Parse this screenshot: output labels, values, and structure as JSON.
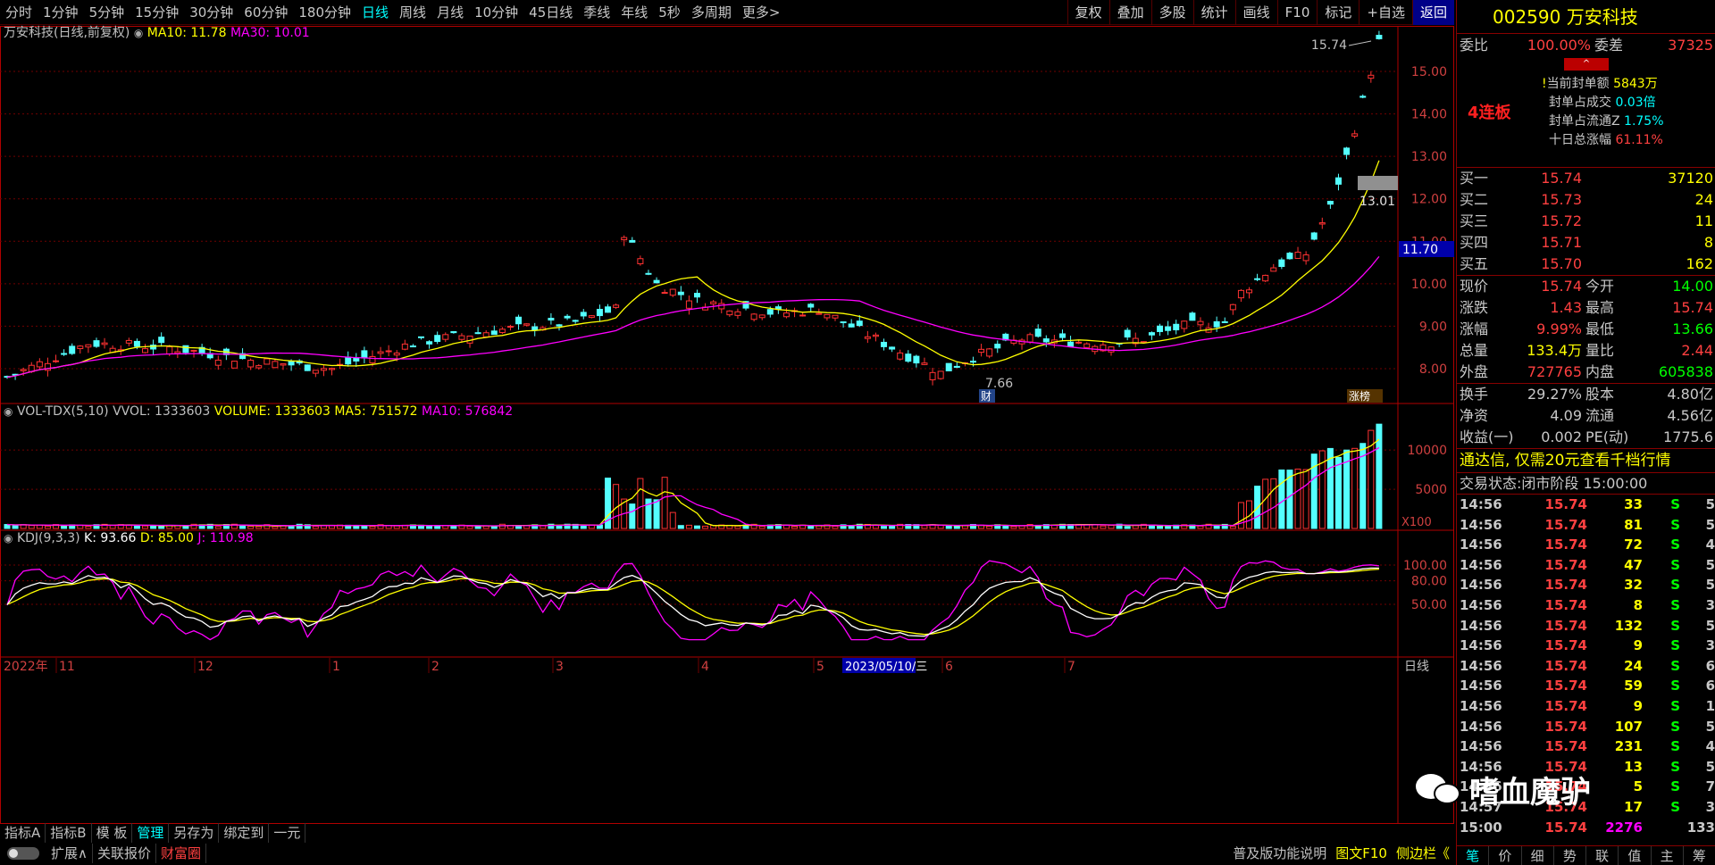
{
  "toolbar": {
    "periods": [
      "分时",
      "1分钟",
      "5分钟",
      "15分钟",
      "30分钟",
      "60分钟",
      "180分钟",
      "日线",
      "周线",
      "月线",
      "10分钟",
      "45日线",
      "季线",
      "年线",
      "5秒",
      "多周期",
      "更多>"
    ],
    "active_period": "日线",
    "right_buttons": [
      "复权",
      "叠加",
      "多股",
      "统计",
      "画线",
      "F10",
      "标记",
      "+自选",
      "返回"
    ],
    "active_right": "返回"
  },
  "main_panel": {
    "title": "万安科技(日线,前复权)",
    "ma10_label": "MA10: 11.78",
    "ma30_label": "MA30: 10.01",
    "ma10_color": "#ffff00",
    "ma30_color": "#ff00ff",
    "price_ticks": [
      "15.00",
      "14.00",
      "13.00",
      "12.00",
      "11.00",
      "10.00",
      "9.00",
      "8.00"
    ],
    "current_price_tag": "11.70",
    "high_label": "15.74",
    "low_label": "7.66",
    "right_label": "13.01",
    "marker_cai": "财",
    "marker_zhang": "涨榜"
  },
  "vol_panel": {
    "title": "VOL-TDX(5,10)",
    "vvol": "VVOL: 1333603",
    "volume": "VOLUME: 1333603",
    "ma5": "MA5: 751572",
    "ma10": "MA10: 576842",
    "ticks": [
      "10000",
      "5000"
    ],
    "unit": "X100"
  },
  "kdj_panel": {
    "title": "KDJ(9,3,3)",
    "k": "K: 93.66",
    "d": "D: 85.00",
    "j": "J: 110.98",
    "ticks": [
      "100.00",
      "80.00",
      "50.00"
    ]
  },
  "date_axis": {
    "labels": [
      "2022年",
      "11",
      "12",
      "1",
      "2",
      "3",
      "4",
      "5",
      "6",
      "7"
    ],
    "cursor_date": "2023/05/10/三",
    "period_tag": "日线"
  },
  "bottom": {
    "row1": [
      "指标A",
      "指标B",
      "模 板",
      "管理",
      "另存为",
      "绑定到",
      "一元"
    ],
    "row1_active": "管理",
    "row2": [
      "扩展∧",
      "关联报价",
      "财富圈"
    ],
    "status_right": [
      "普及版功能说明",
      "图文F10",
      "侧边栏《"
    ]
  },
  "quote": {
    "code": "002590",
    "name": "万安科技",
    "weibi_label": "委比",
    "weibi": "100.00%",
    "weicha_label": "委差",
    "weicha": "37325",
    "lianban": "4连板",
    "seal_amount_label": "当前封单额",
    "seal_amount": "5843万",
    "seal_deal_label": "封单占成交",
    "seal_deal": "0.03倍",
    "seal_float_label": "封单占流通Z",
    "seal_float": "1.75%",
    "ten_day_label": "十日总涨幅",
    "ten_day": "61.11%",
    "bids": [
      {
        "label": "买一",
        "price": "15.74",
        "vol": "37120"
      },
      {
        "label": "买二",
        "price": "15.73",
        "vol": "24"
      },
      {
        "label": "买三",
        "price": "15.72",
        "vol": "11"
      },
      {
        "label": "买四",
        "price": "15.71",
        "vol": "8"
      },
      {
        "label": "买五",
        "price": "15.70",
        "vol": "162"
      }
    ],
    "stats": [
      {
        "l1": "现价",
        "v1": "15.74",
        "l2": "今开",
        "v2": "14.00"
      },
      {
        "l1": "涨跌",
        "v1": "1.43",
        "l2": "最高",
        "v2": "15.74"
      },
      {
        "l1": "涨幅",
        "v1": "9.99%",
        "l2": "最低",
        "v2": "13.66"
      },
      {
        "l1": "总量",
        "v1": "133.4万",
        "l2": "量比",
        "v2": "2.44"
      },
      {
        "l1": "外盘",
        "v1": "727765",
        "l2": "内盘",
        "v2": "605838"
      }
    ],
    "stats2": [
      {
        "l1": "换手",
        "v1": "29.27%",
        "l2": "股本",
        "v2": "4.80亿"
      },
      {
        "l1": "净资",
        "v1": "4.09",
        "l2": "流通",
        "v2": "4.56亿"
      },
      {
        "l1": "收益(一)",
        "v1": "0.002",
        "l2": "PE(动)",
        "v2": "1775.6"
      }
    ],
    "ad": "通达信, 仅需20元查看千档行情",
    "trade_status_label": "交易状态:",
    "trade_status": "闭市阶段 15:00:00",
    "ticks": [
      {
        "t": "14:56",
        "p": "15.74",
        "v": "33",
        "s": "S",
        "n": "5"
      },
      {
        "t": "14:56",
        "p": "15.74",
        "v": "81",
        "s": "S",
        "n": "5"
      },
      {
        "t": "14:56",
        "p": "15.74",
        "v": "72",
        "s": "S",
        "n": "4"
      },
      {
        "t": "14:56",
        "p": "15.74",
        "v": "47",
        "s": "S",
        "n": "5"
      },
      {
        "t": "14:56",
        "p": "15.74",
        "v": "32",
        "s": "S",
        "n": "5"
      },
      {
        "t": "14:56",
        "p": "15.74",
        "v": "8",
        "s": "S",
        "n": "3"
      },
      {
        "t": "14:56",
        "p": "15.74",
        "v": "132",
        "s": "S",
        "n": "5"
      },
      {
        "t": "14:56",
        "p": "15.74",
        "v": "9",
        "s": "S",
        "n": "3"
      },
      {
        "t": "14:56",
        "p": "15.74",
        "v": "24",
        "s": "S",
        "n": "6"
      },
      {
        "t": "14:56",
        "p": "15.74",
        "v": "59",
        "s": "S",
        "n": "6"
      },
      {
        "t": "14:56",
        "p": "15.74",
        "v": "9",
        "s": "S",
        "n": "1"
      },
      {
        "t": "14:56",
        "p": "15.74",
        "v": "107",
        "s": "S",
        "n": "5"
      },
      {
        "t": "14:56",
        "p": "15.74",
        "v": "231",
        "s": "S",
        "n": "4"
      },
      {
        "t": "14:56",
        "p": "15.74",
        "v": "13",
        "s": "S",
        "n": "5"
      },
      {
        "t": "14:56",
        "p": "15.74",
        "v": "5",
        "s": "S",
        "n": "7"
      },
      {
        "t": "14:57",
        "p": "15.74",
        "v": "17",
        "s": "S",
        "n": "3"
      },
      {
        "t": "15:00",
        "p": "15.74",
        "v": "2276",
        "s": "",
        "n": "133"
      }
    ],
    "tabs": [
      "笔",
      "价",
      "细",
      "势",
      "联",
      "值",
      "主",
      "筹"
    ],
    "active_tab": "笔"
  },
  "watermark": "嗜血魔驴"
}
